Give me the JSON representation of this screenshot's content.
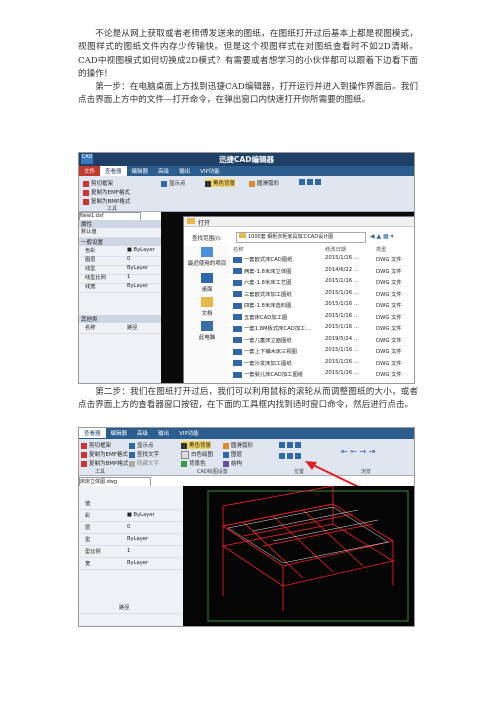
{
  "intro": {
    "paragraph1": "不论是从网上获取或者老师傅发送来的图纸，在图纸打开过后基本上都是视图模式，视图样式的图纸文件内存少传输快。但是这个视图样式在对图纸查看时不如2D清晰。CAD中视图模式如何切换成2D模式？有需要或者想学习的小伙伴都可以跟着下边看下面的操作！",
    "step1": "第一步：在电脑桌面上方找到迅捷CAD编辑器，打开运行并进入到操作界面后。我们点击界面上方中的文件—打开命令，在弹出窗口内快速打开你所需要的图纸。",
    "step2": "第二步：我们在图纸打开过后，我们可以利用鼠标的滚轮从而调整图纸的大小，或者点击界面上方的查看器窗口按钮，在下面的工具框内找到适时窗口命令，然后进行点击。"
  },
  "shot1": {
    "app_title": "迅捷CAD编辑器",
    "menu": [
      "文件",
      "查看器",
      "编辑器",
      "高级",
      "输出",
      "VIP功能"
    ],
    "ribbon": {
      "clip": "剪切框架",
      "copy_emf": "复制为EMF格式",
      "copy_bmp": "复制为BMP格式",
      "tools_group": "工具",
      "show_points": "显示点",
      "black_bg": "黑色背景",
      "smooth_arc": "圆滑弧形"
    },
    "doc_tab": "New1.dxf",
    "props": {
      "header": "属性",
      "default": "默认值",
      "general": "一般设置",
      "rows": [
        {
          "k": "色彩",
          "v": "■ ByLayer"
        },
        {
          "k": "图层",
          "v": "0"
        },
        {
          "k": "线型",
          "v": "ByLayer"
        },
        {
          "k": "线型比例",
          "v": "1"
        },
        {
          "k": "线宽",
          "v": "ByLayer"
        }
      ],
      "section2": "其他类",
      "name_label": "名称",
      "path_label": "路径"
    },
    "dialog": {
      "title": "打开",
      "lookin_label": "查找范围(I):",
      "lookin_value": "1000套 橱柜衣柜家具加工CAD设计图",
      "places": [
        "最近使用的项目",
        "桌面",
        "文档",
        "此电脑"
      ],
      "columns": [
        "名称",
        "修改日期",
        "类型"
      ],
      "files": [
        {
          "name": "一套欧式床CAD图纸",
          "date": "2015/1/16 ...",
          "type": "DWG 文件"
        },
        {
          "name": "两套-1.8米床立体图",
          "date": "2014/6/22 ...",
          "type": "DWG 文件"
        },
        {
          "name": "六套-1.8米床工艺图",
          "date": "2015/1/16 ...",
          "type": "DWG 文件"
        },
        {
          "name": "三套欧式床加工图纸",
          "date": "2015/1/16 ...",
          "type": "DWG 文件"
        },
        {
          "name": "四套-1.8米床选料图",
          "date": "2015/1/16 ...",
          "type": "DWG 文件"
        },
        {
          "name": "五套床CAD加工图",
          "date": "2015/1/16 ...",
          "type": "DWG 文件"
        },
        {
          "name": "一套1.8M板式床CAD加工...",
          "date": "2015/1/16 ...",
          "type": "DWG 文件"
        },
        {
          "name": "一套儿童床立面图纸",
          "date": "2019/5/24 ...",
          "type": "DWG 文件"
        },
        {
          "name": "一套上下铺木床三视图",
          "date": "2015/1/16 ...",
          "type": "DWG 文件"
        },
        {
          "name": "一套沙发床加工图纸",
          "date": "2015/1/16 ...",
          "type": "DWG 文件"
        },
        {
          "name": "一套婴儿床CAD加工图纸",
          "date": "2015/1/16 ...",
          "type": "DWG 文件"
        }
      ]
    }
  },
  "shot2": {
    "menu": [
      "查看器",
      "编辑器",
      "高级",
      "输出",
      "VIP功能"
    ],
    "ribbon": {
      "clip": "剪切框架",
      "copy_emf": "复制为EMF格式",
      "copy_bmp": "复制为BMP格式",
      "show_points": "显示点",
      "find_text": "查找文字",
      "hide_text": "隐藏文字",
      "black_bg": "黑色背景",
      "white_bg": "白色绘图",
      "bg_color": "背景色",
      "smooth_arc": "圆滑弧形",
      "layers": "图层",
      "structure": "结构",
      "groups": [
        "工具",
        "CAD绘图设置",
        "位置",
        "浏览"
      ]
    },
    "doc_tab": "床床立体图.dwg",
    "props": {
      "rows": [
        {
          "k": "值",
          "v": ""
        },
        {
          "k": "彩",
          "v": "■ ByLayer"
        },
        {
          "k": "层",
          "v": "0"
        },
        {
          "k": "型",
          "v": "ByLayer"
        },
        {
          "k": "型比例",
          "v": "1"
        },
        {
          "k": "宽",
          "v": "ByLayer"
        }
      ],
      "path_label": "路径"
    }
  },
  "colors": {
    "accent": "#1f3f66",
    "cad_lines": "#ff2020",
    "cad_bg": "#050505"
  }
}
